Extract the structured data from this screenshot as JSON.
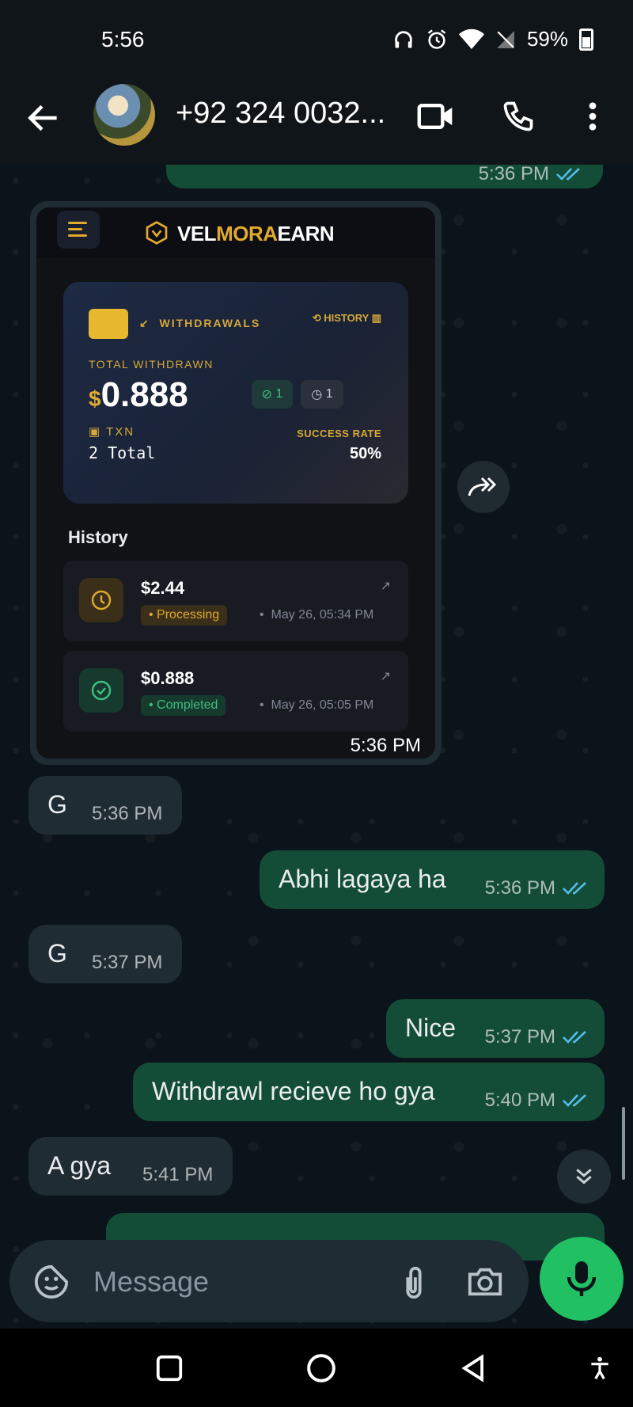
{
  "status_bar": {
    "time": "5:56",
    "battery": "59%"
  },
  "header": {
    "contact_name": "+92 324 0032..."
  },
  "screenshot": {
    "brand_prefix": "VEL",
    "brand_middle": "MORA",
    "brand_suffix": "EARN",
    "card": {
      "label": "WITHDRAWALS",
      "history_link": "HISTORY",
      "total_label": "TOTAL WITHDRAWN",
      "currency": "$",
      "amount": "0.888",
      "completed_count": "1",
      "pending_count": "1",
      "txn_label": "TXN",
      "txn_value": "2 Total",
      "success_label": "SUCCESS RATE",
      "success_value": "50%"
    },
    "history_title": "History",
    "history": [
      {
        "amount": "$2.44",
        "status": "Processing",
        "date": "May 26, 05:34 PM"
      },
      {
        "amount": "$0.888",
        "status": "Completed",
        "date": "May 26, 05:05 PM"
      }
    ]
  },
  "messages": {
    "top_partial_time": "5:36 PM",
    "image_time": "5:36 PM",
    "m1": {
      "text": "G",
      "time": "5:36 PM"
    },
    "m2": {
      "text": "Abhi lagaya ha",
      "time": "5:36 PM"
    },
    "m3": {
      "text": "G",
      "time": "5:37 PM"
    },
    "m4": {
      "text": "Nice",
      "time": "5:37 PM"
    },
    "m5": {
      "text": "Withdrawl recieve ho gya",
      "time": "5:40 PM"
    },
    "m6": {
      "text": "A gya",
      "time": "5:41 PM"
    }
  },
  "input": {
    "placeholder": "Message"
  },
  "colors": {
    "outgoing": "#144d37",
    "incoming": "#202c33",
    "accent": "#21c063",
    "tick_read": "#53bdeb"
  }
}
